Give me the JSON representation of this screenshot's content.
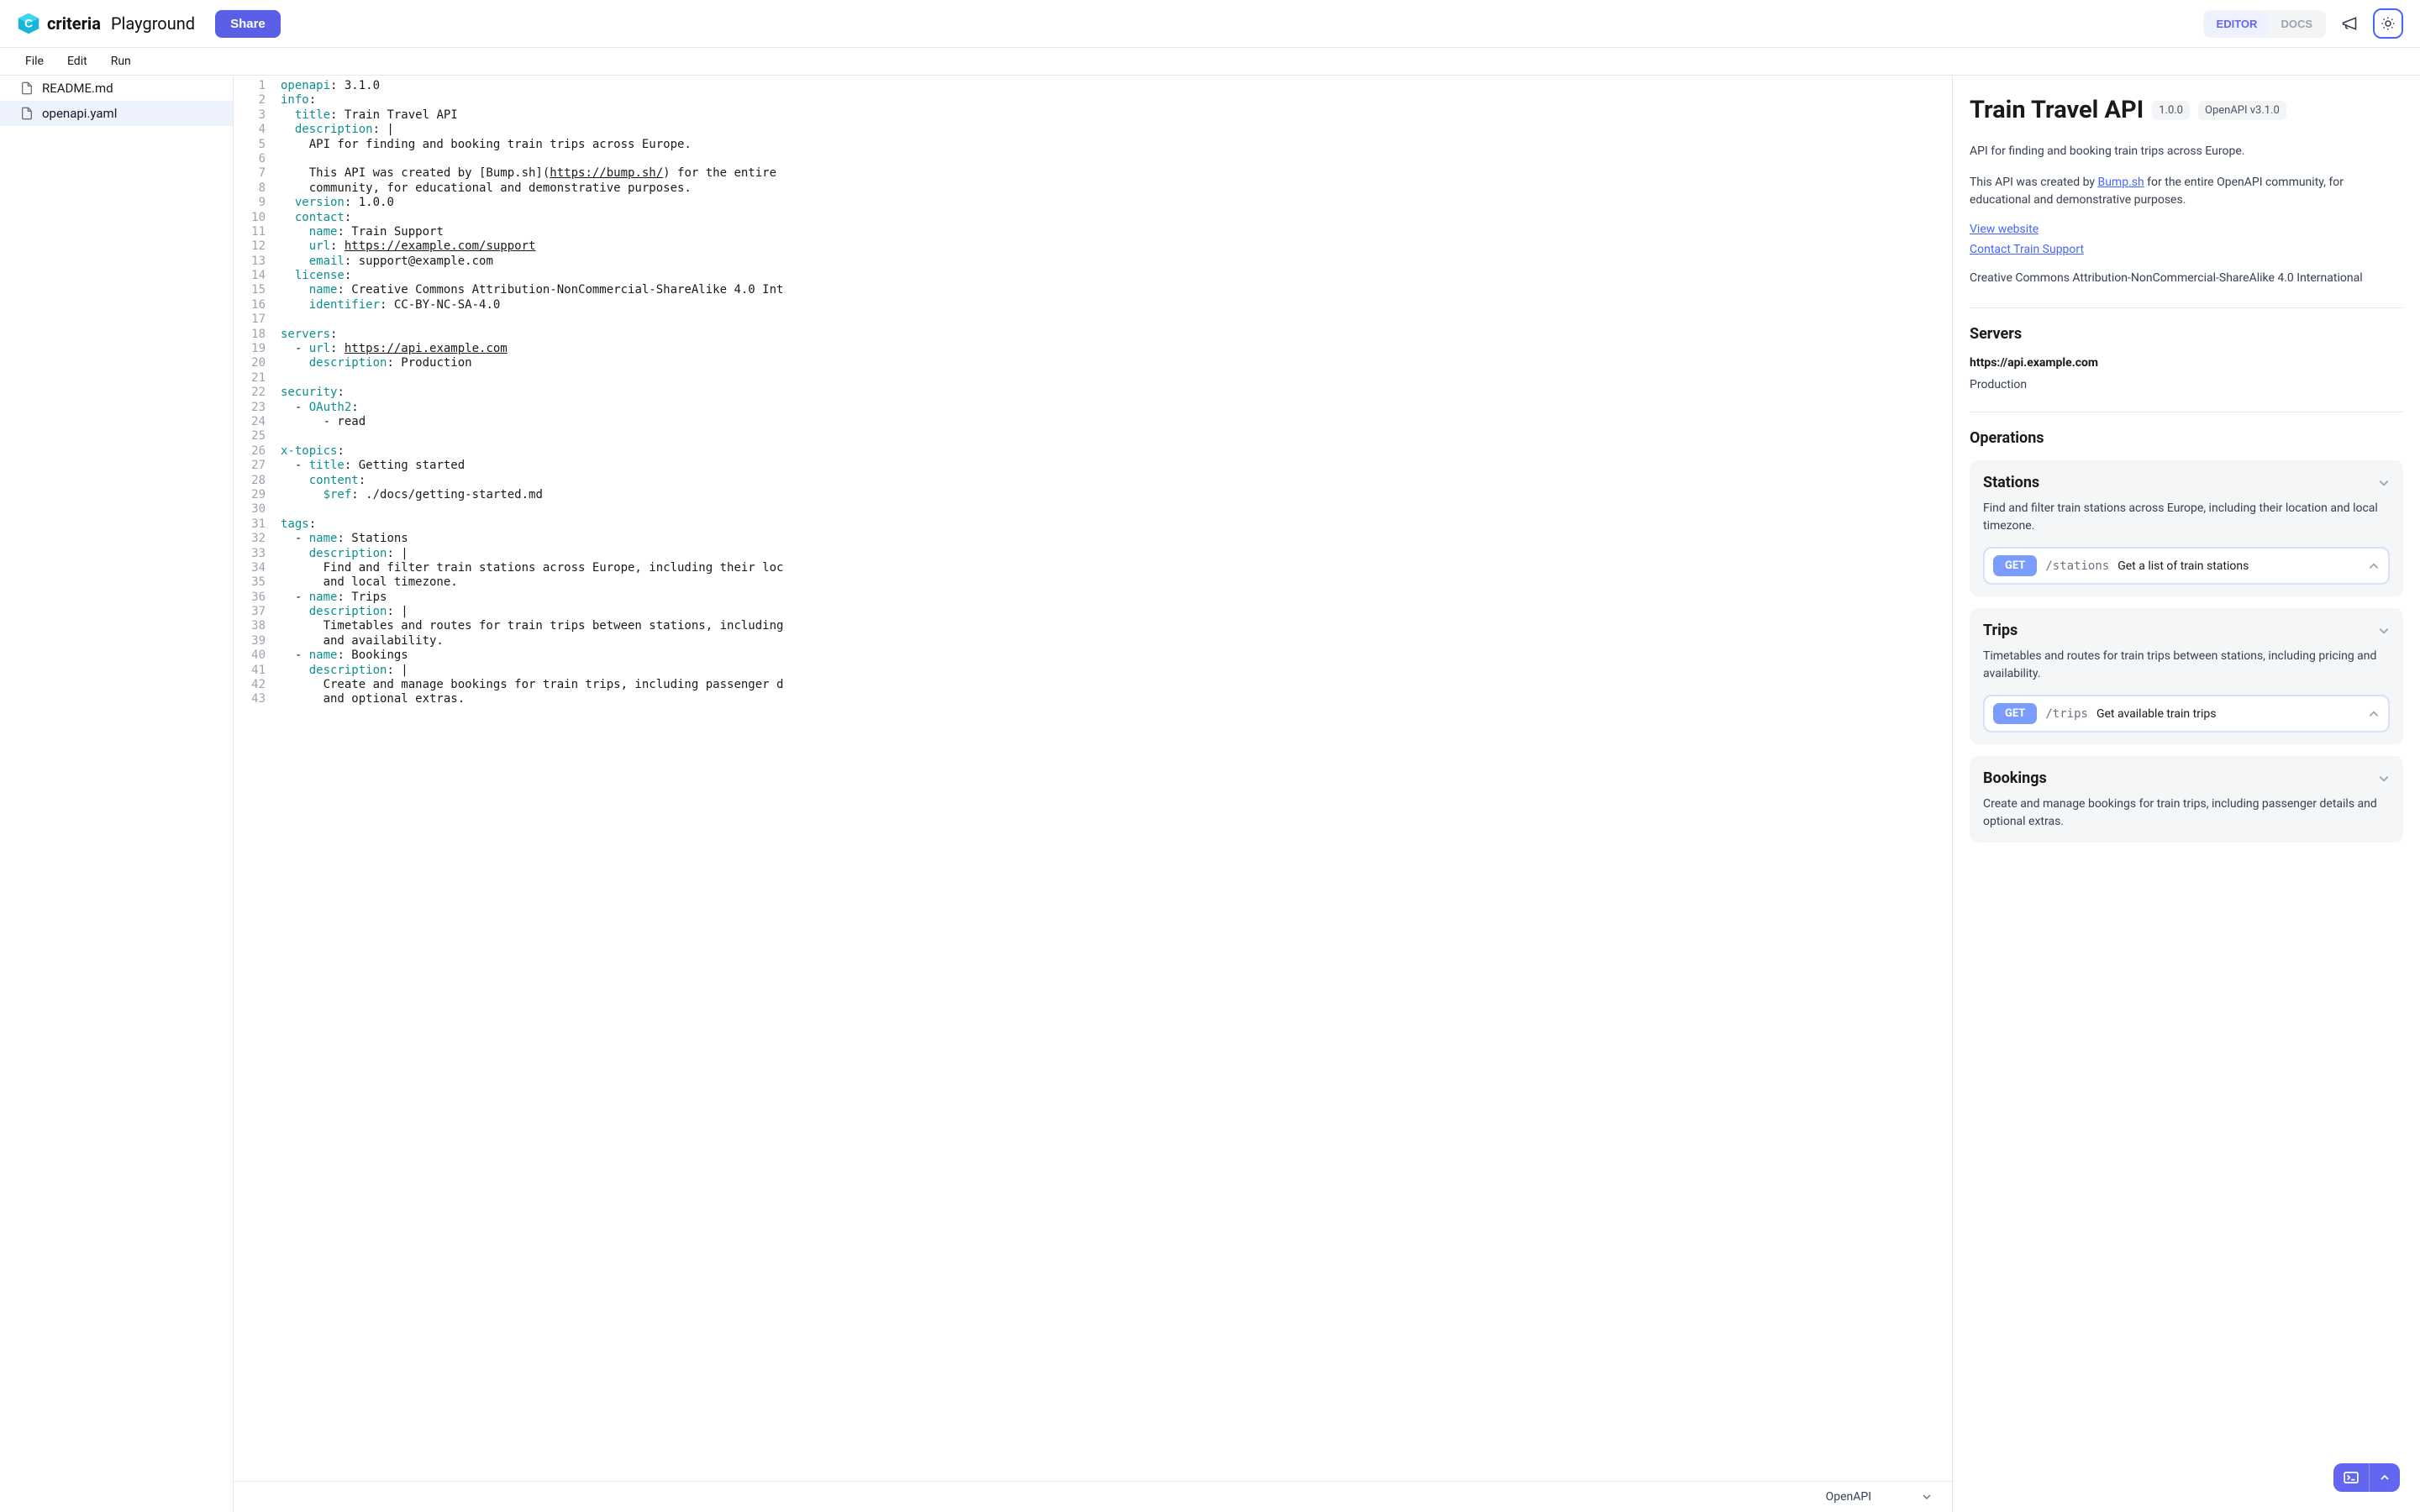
{
  "brand": {
    "name": "criteria",
    "sub": "Playground"
  },
  "header": {
    "share": "Share",
    "tabs": {
      "editor": "EDITOR",
      "docs": "DOCS"
    }
  },
  "menu": {
    "file": "File",
    "edit": "Edit",
    "run": "Run"
  },
  "files": [
    {
      "name": "README.md",
      "active": false
    },
    {
      "name": "openapi.yaml",
      "active": true
    }
  ],
  "editor_footer": {
    "lang": "OpenAPI"
  },
  "code_lines": [
    [
      [
        "k",
        "openapi"
      ],
      [
        "s",
        ": 3.1.0"
      ]
    ],
    [
      [
        "k",
        "info"
      ],
      [
        "s",
        ":"
      ]
    ],
    [
      [
        "s",
        "  "
      ],
      [
        "k",
        "title"
      ],
      [
        "s",
        ": Train Travel API"
      ]
    ],
    [
      [
        "s",
        "  "
      ],
      [
        "k",
        "description"
      ],
      [
        "s",
        ": |"
      ]
    ],
    [
      [
        "s",
        "    API for finding and booking train trips across Europe."
      ]
    ],
    [
      [
        "s",
        ""
      ]
    ],
    [
      [
        "s",
        "    This API was created by [Bump.sh]("
      ],
      [
        "u",
        "https://bump.sh/"
      ],
      [
        "s",
        ") for the entire "
      ]
    ],
    [
      [
        "s",
        "    community, for educational and demonstrative purposes."
      ]
    ],
    [
      [
        "s",
        "  "
      ],
      [
        "k",
        "version"
      ],
      [
        "s",
        ": 1.0.0"
      ]
    ],
    [
      [
        "s",
        "  "
      ],
      [
        "k",
        "contact"
      ],
      [
        "s",
        ":"
      ]
    ],
    [
      [
        "s",
        "    "
      ],
      [
        "k",
        "name"
      ],
      [
        "s",
        ": Train Support"
      ]
    ],
    [
      [
        "s",
        "    "
      ],
      [
        "k",
        "url"
      ],
      [
        "s",
        ": "
      ],
      [
        "u",
        "https://example.com/support"
      ]
    ],
    [
      [
        "s",
        "    "
      ],
      [
        "k",
        "email"
      ],
      [
        "s",
        ": support@example.com"
      ]
    ],
    [
      [
        "s",
        "  "
      ],
      [
        "k",
        "license"
      ],
      [
        "s",
        ":"
      ]
    ],
    [
      [
        "s",
        "    "
      ],
      [
        "k",
        "name"
      ],
      [
        "s",
        ": Creative Commons Attribution-NonCommercial-ShareAlike 4.0 Int"
      ]
    ],
    [
      [
        "s",
        "    "
      ],
      [
        "k",
        "identifier"
      ],
      [
        "s",
        ": CC-BY-NC-SA-4.0"
      ]
    ],
    [
      [
        "s",
        ""
      ]
    ],
    [
      [
        "k",
        "servers"
      ],
      [
        "s",
        ":"
      ]
    ],
    [
      [
        "s",
        "  - "
      ],
      [
        "k",
        "url"
      ],
      [
        "s",
        ": "
      ],
      [
        "u",
        "https://api.example.com"
      ]
    ],
    [
      [
        "s",
        "    "
      ],
      [
        "k",
        "description"
      ],
      [
        "s",
        ": Production"
      ]
    ],
    [
      [
        "s",
        ""
      ]
    ],
    [
      [
        "k",
        "security"
      ],
      [
        "s",
        ":"
      ]
    ],
    [
      [
        "s",
        "  - "
      ],
      [
        "k",
        "OAuth2"
      ],
      [
        "s",
        ":"
      ]
    ],
    [
      [
        "s",
        "      - read"
      ]
    ],
    [
      [
        "s",
        ""
      ]
    ],
    [
      [
        "k",
        "x-topics"
      ],
      [
        "s",
        ":"
      ]
    ],
    [
      [
        "s",
        "  - "
      ],
      [
        "k",
        "title"
      ],
      [
        "s",
        ": Getting started"
      ]
    ],
    [
      [
        "s",
        "    "
      ],
      [
        "k",
        "content"
      ],
      [
        "s",
        ":"
      ]
    ],
    [
      [
        "s",
        "      "
      ],
      [
        "k",
        "$ref"
      ],
      [
        "s",
        ": ./docs/getting-started.md"
      ]
    ],
    [
      [
        "s",
        ""
      ]
    ],
    [
      [
        "k",
        "tags"
      ],
      [
        "s",
        ":"
      ]
    ],
    [
      [
        "s",
        "  - "
      ],
      [
        "k",
        "name"
      ],
      [
        "s",
        ": Stations"
      ]
    ],
    [
      [
        "s",
        "    "
      ],
      [
        "k",
        "description"
      ],
      [
        "s",
        ": |"
      ]
    ],
    [
      [
        "s",
        "      Find and filter train stations across Europe, including their loc"
      ]
    ],
    [
      [
        "s",
        "      and local timezone."
      ]
    ],
    [
      [
        "s",
        "  - "
      ],
      [
        "k",
        "name"
      ],
      [
        "s",
        ": Trips"
      ]
    ],
    [
      [
        "s",
        "    "
      ],
      [
        "k",
        "description"
      ],
      [
        "s",
        ": |"
      ]
    ],
    [
      [
        "s",
        "      Timetables and routes for train trips between stations, including"
      ]
    ],
    [
      [
        "s",
        "      and availability."
      ]
    ],
    [
      [
        "s",
        "  - "
      ],
      [
        "k",
        "name"
      ],
      [
        "s",
        ": Bookings"
      ]
    ],
    [
      [
        "s",
        "    "
      ],
      [
        "k",
        "description"
      ],
      [
        "s",
        ": |"
      ]
    ],
    [
      [
        "s",
        "      Create and manage bookings for train trips, including passenger d"
      ]
    ],
    [
      [
        "s",
        "      and optional extras."
      ]
    ]
  ],
  "docs": {
    "title": "Train Travel API",
    "version_badge": "1.0.0",
    "spec_badge": "OpenAPI v3.1.0",
    "intro1": "API for finding and booking train trips across Europe.",
    "intro2_pre": "This API was created by ",
    "intro2_link": "Bump.sh",
    "intro2_post": " for the entire OpenAPI community, for educational and demonstrative purposes.",
    "link_view": "View website",
    "link_contact": "Contact Train Support",
    "license": "Creative Commons Attribution-NonCommercial-ShareAlike 4.0 International",
    "servers_h": "Servers",
    "server_url": "https://api.example.com",
    "server_desc": "Production",
    "operations_h": "Operations",
    "groups": [
      {
        "title": "Stations",
        "desc": "Find and filter train stations across Europe, including their location and local timezone.",
        "method": "GET",
        "path": "/stations",
        "summary": "Get a list of train stations"
      },
      {
        "title": "Trips",
        "desc": "Timetables and routes for train trips between stations, including pricing and availability.",
        "method": "GET",
        "path": "/trips",
        "summary": "Get available train trips"
      },
      {
        "title": "Bookings",
        "desc": "Create and manage bookings for train trips, including passenger details and optional extras."
      }
    ]
  }
}
